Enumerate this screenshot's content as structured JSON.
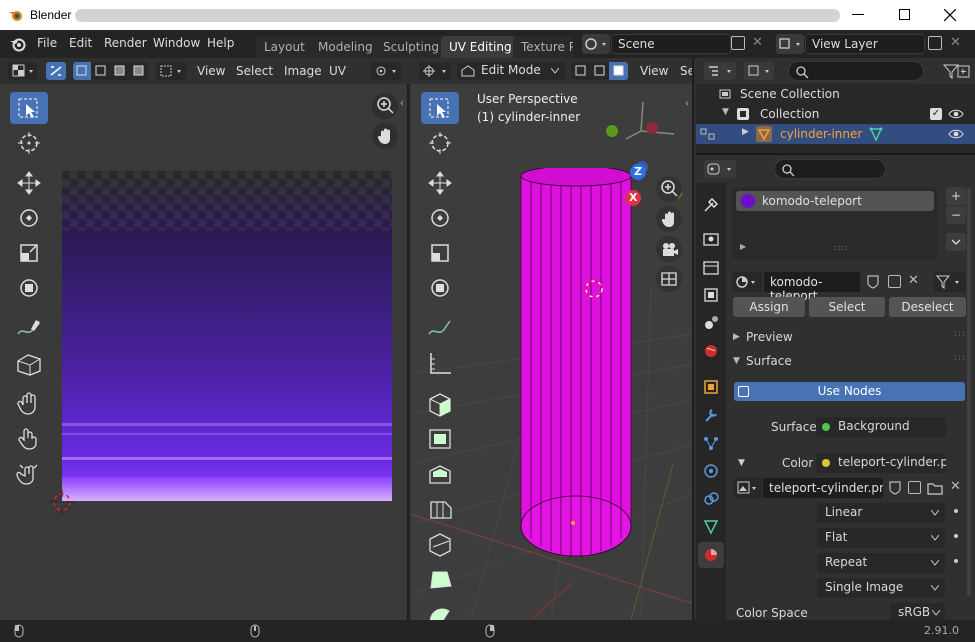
{
  "window": {
    "app_title": "Blender"
  },
  "menu": [
    "File",
    "Edit",
    "Render",
    "Window",
    "Help"
  ],
  "workspaces": [
    "Layout",
    "Modeling",
    "Sculpting",
    "UV Editing",
    "Texture Pa"
  ],
  "active_workspace": "UV Editing",
  "scene": {
    "name": "Scene",
    "view_layer": "View Layer"
  },
  "uv_editor": {
    "menus": [
      "View",
      "Select",
      "Image",
      "UV"
    ]
  },
  "viewport": {
    "mode": "Edit Mode",
    "menus": [
      "View",
      "Se"
    ],
    "perspective": "User Perspective",
    "object_label": "(1) cylinder-inner",
    "gizmo": {
      "x": "X",
      "y": "Y",
      "z": "Z"
    }
  },
  "outliner": {
    "scene_collection": "Scene Collection",
    "collection": "Collection",
    "object": "cylinder-inner"
  },
  "material": {
    "slot_name": "komodo-teleport",
    "material_name": "komodo-teleport",
    "assign": "Assign",
    "select": "Select",
    "deselect": "Deselect",
    "preview": "Preview",
    "surface_header": "Surface",
    "use_nodes": "Use Nodes",
    "surface_label": "Surface",
    "surface_value": "Background",
    "color_label": "Color",
    "color_value": "teleport-cylinder.png",
    "image_name": "teleport-cylinder.png",
    "interpolation": "Linear",
    "projection": "Flat",
    "extension": "Repeat",
    "source": "Single Image",
    "color_space_label": "Color Space",
    "color_space_value": "sRGB"
  },
  "status": {
    "version": "2.91.0"
  },
  "colors": {
    "accent": "#4772b3",
    "mesh": "#e010e0",
    "selected_row": "#334d80",
    "object_label": "#f2a23a",
    "uv_purple_dark": "#2a1a52",
    "uv_purple": "#7a2bf0"
  }
}
